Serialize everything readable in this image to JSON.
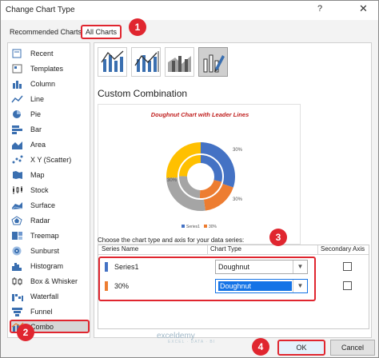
{
  "window": {
    "title": "Change Chart Type",
    "help_glyph": "?",
    "close_glyph": "✕"
  },
  "tabs": {
    "recommended": "Recommended Charts",
    "all": "All Charts"
  },
  "markers": [
    "1",
    "2",
    "3",
    "4"
  ],
  "sidebar": {
    "items": [
      {
        "label": "Recent",
        "icon": "recent-icon"
      },
      {
        "label": "Templates",
        "icon": "templates-icon"
      },
      {
        "label": "Column",
        "icon": "column-chart-icon"
      },
      {
        "label": "Line",
        "icon": "line-chart-icon"
      },
      {
        "label": "Pie",
        "icon": "pie-chart-icon"
      },
      {
        "label": "Bar",
        "icon": "bar-chart-icon"
      },
      {
        "label": "Area",
        "icon": "area-chart-icon"
      },
      {
        "label": "X Y (Scatter)",
        "icon": "scatter-chart-icon"
      },
      {
        "label": "Map",
        "icon": "map-chart-icon"
      },
      {
        "label": "Stock",
        "icon": "stock-chart-icon"
      },
      {
        "label": "Surface",
        "icon": "surface-chart-icon"
      },
      {
        "label": "Radar",
        "icon": "radar-chart-icon"
      },
      {
        "label": "Treemap",
        "icon": "treemap-icon"
      },
      {
        "label": "Sunburst",
        "icon": "sunburst-icon"
      },
      {
        "label": "Histogram",
        "icon": "histogram-icon"
      },
      {
        "label": "Box & Whisker",
        "icon": "box-whisker-icon"
      },
      {
        "label": "Waterfall",
        "icon": "waterfall-icon"
      },
      {
        "label": "Funnel",
        "icon": "funnel-icon"
      },
      {
        "label": "Combo",
        "icon": "combo-chart-icon",
        "selected": true
      }
    ]
  },
  "main": {
    "section_title": "Custom Combination",
    "preview_title": "Doughnut Chart with Leader Lines",
    "preview_legend": [
      "Series1",
      "30%"
    ],
    "preview_label": "30%",
    "choose_text": "Choose the chart type and axis for your data series:",
    "grid_headers": {
      "name": "Series Name",
      "type": "Chart Type",
      "secondary": "Secondary Axis"
    },
    "rows": [
      {
        "name": "Series1",
        "type": "Doughnut",
        "color": "#4472c4"
      },
      {
        "name": "30%",
        "type": "Doughnut",
        "color": "#ed7d31"
      }
    ]
  },
  "watermark": {
    "brand": "exceldemy",
    "tagline": "EXCEL · DATA · BI"
  },
  "buttons": {
    "ok": "OK",
    "cancel": "Cancel"
  },
  "colors": {
    "accent_red": "#e0262f",
    "select_blue": "#1473e6",
    "orange": "#ed7d31",
    "blue": "#4472c4",
    "gray": "#a5a5a5",
    "yellow": "#ffc000"
  }
}
